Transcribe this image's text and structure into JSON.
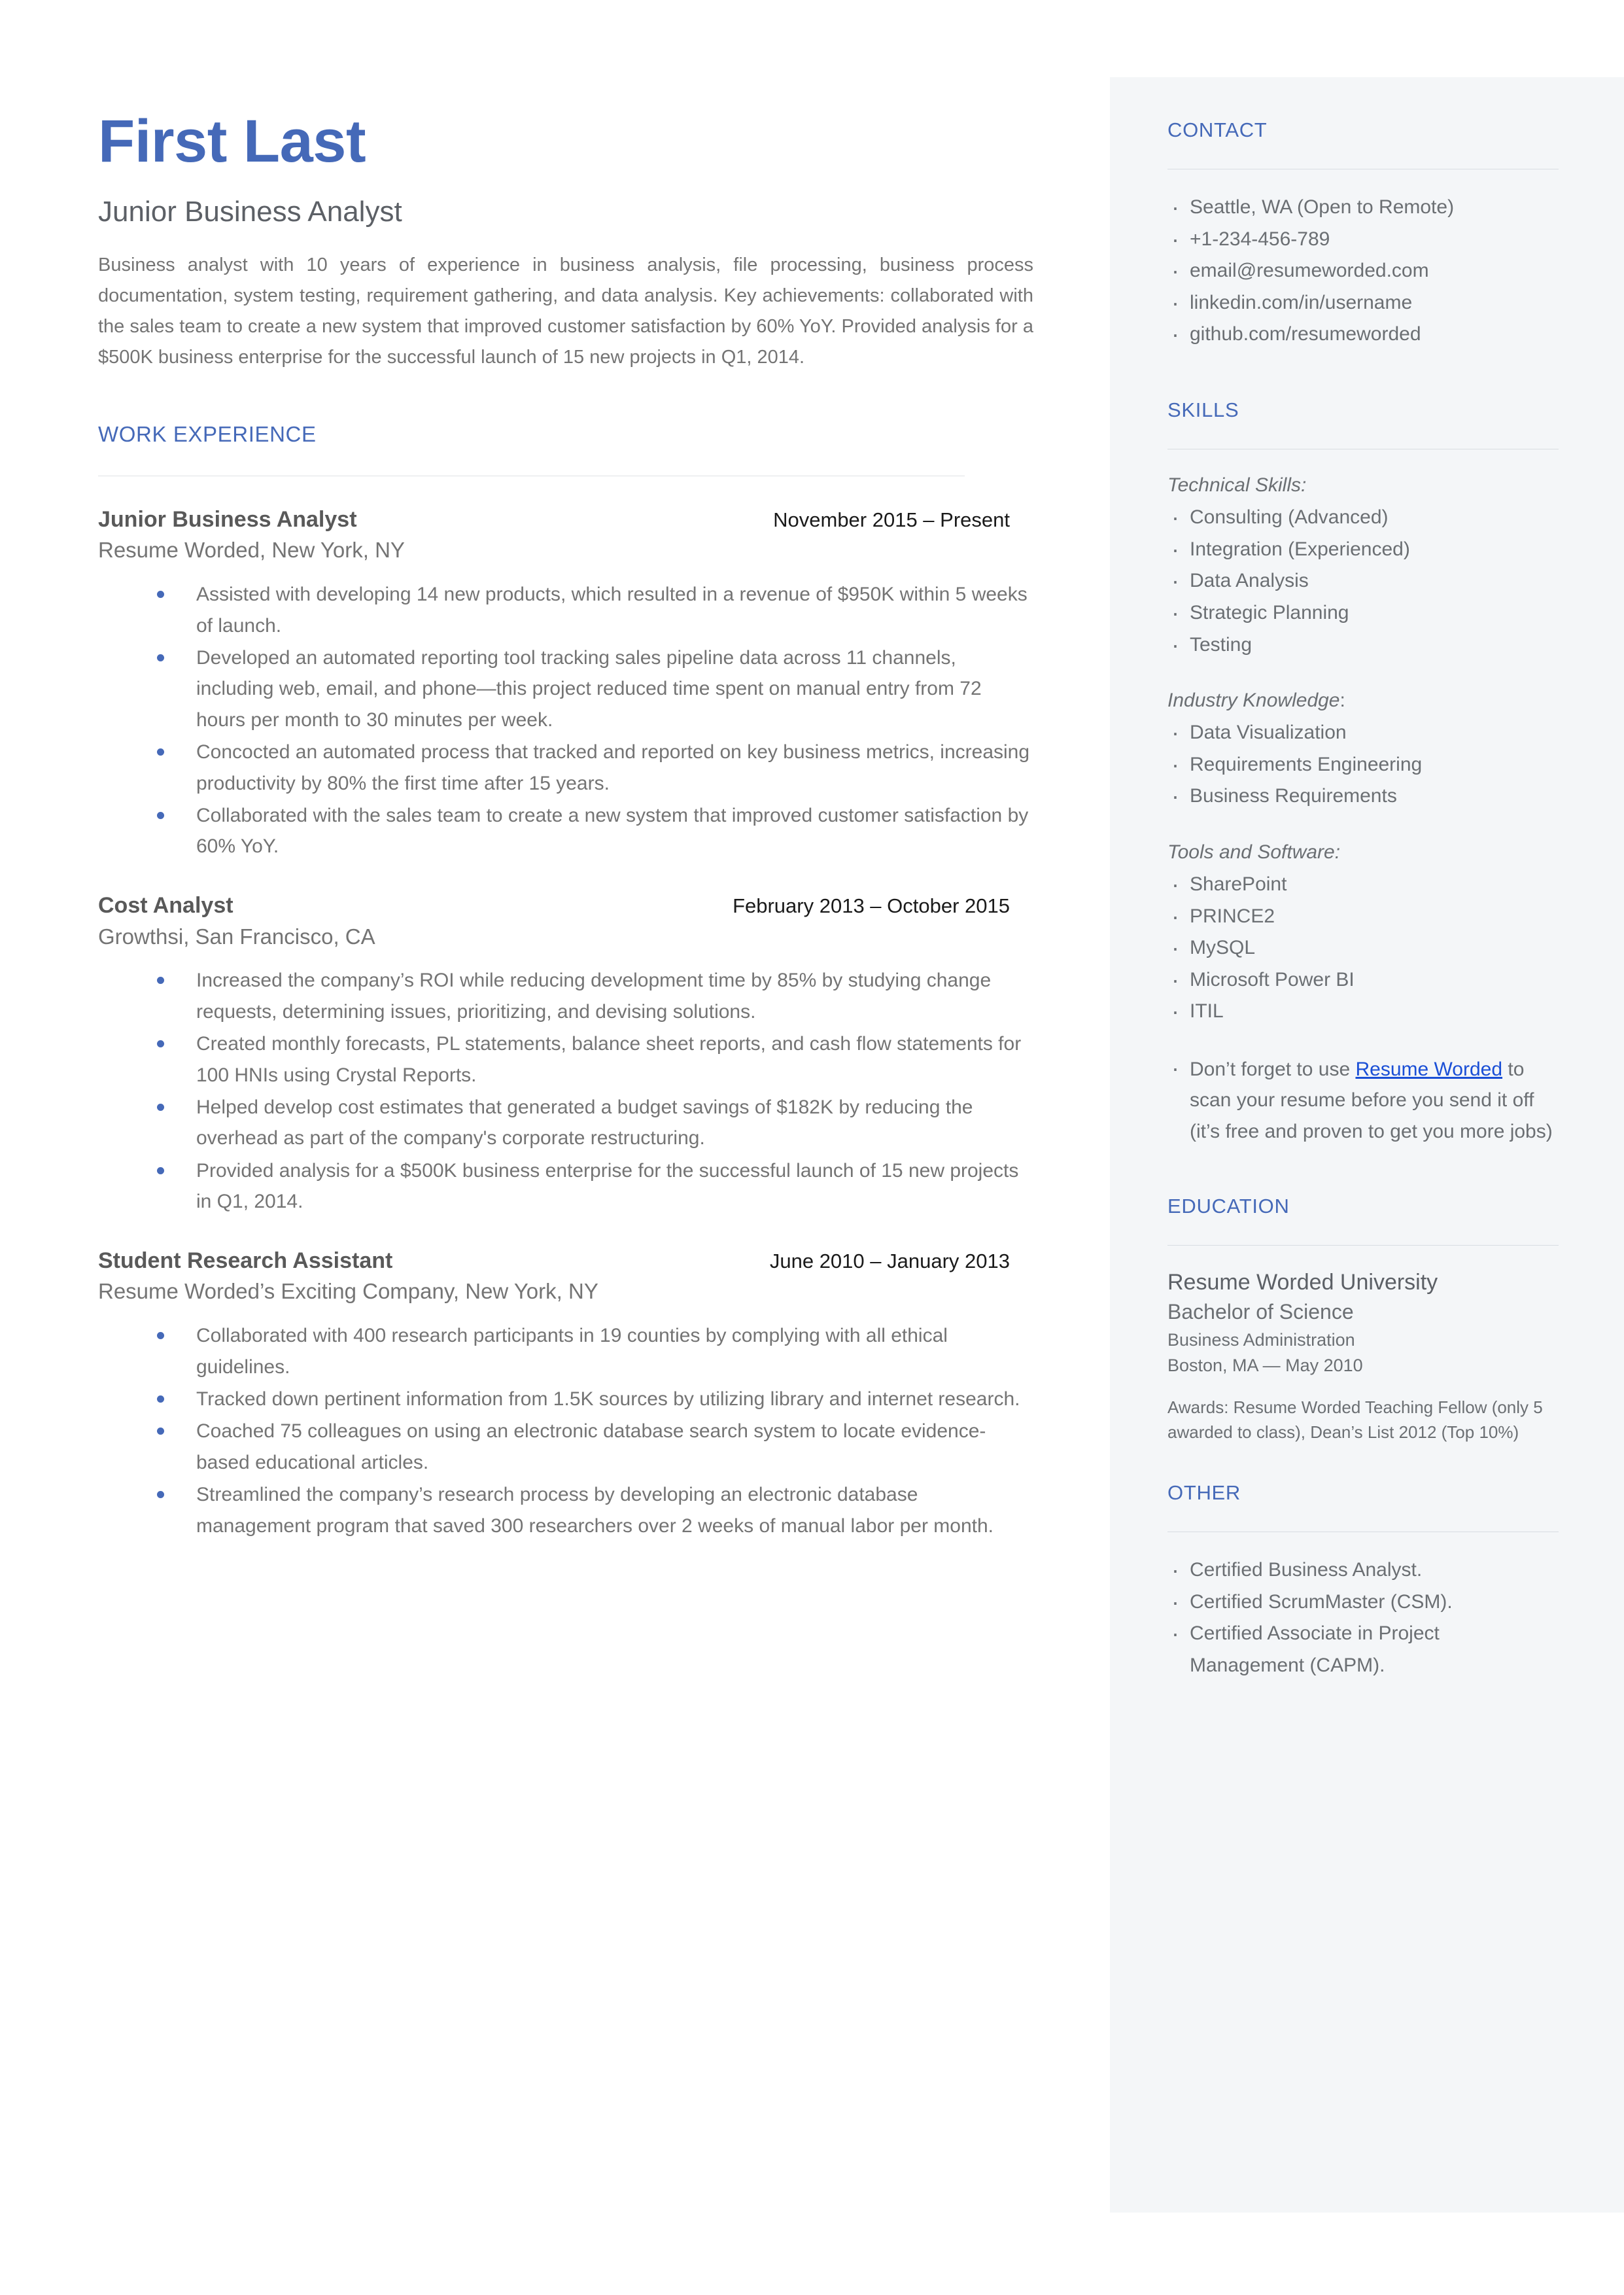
{
  "header": {
    "name": "First Last",
    "role": "Junior Business Analyst",
    "summary": "Business analyst with 10 years of experience in business analysis, file processing, business process documentation, system testing, requirement gathering, and data analysis. Key achievements: collaborated with the sales team to create a new system that improved customer satisfaction by 60% YoY. Provided analysis for a $500K business enterprise for the successful launch of 15 new projects in Q1, 2014."
  },
  "work": {
    "heading": "WORK EXPERIENCE",
    "jobs": [
      {
        "title": "Junior Business Analyst",
        "date": "November 2015 – Present",
        "company": "Resume Worded, New York, NY",
        "bullets": [
          "Assisted with developing 14 new products, which resulted in a revenue of $950K within 5 weeks of launch.",
          "Developed an automated reporting tool tracking sales pipeline data across 11 channels, including web, email, and phone—this project reduced time spent on manual entry from 72 hours per month to 30 minutes per week.",
          "Concocted an automated process that tracked and reported on key business metrics, increasing productivity by 80% the first time after 15 years.",
          "Collaborated with the sales team to create a new system that improved customer satisfaction by 60% YoY."
        ]
      },
      {
        "title": "Cost Analyst",
        "date": "February 2013 – October 2015",
        "company": "Growthsi, San Francisco, CA",
        "bullets": [
          "Increased the company’s ROI while reducing development time by 85% by studying change requests, determining issues, prioritizing, and devising solutions.",
          "Created monthly forecasts, PL statements, balance sheet reports, and cash flow statements for 100 HNIs using Crystal Reports.",
          "Helped develop cost estimates that generated a budget savings of $182K  by reducing the overhead as part of the company's corporate restructuring.",
          "Provided analysis for a $500K business enterprise for the successful launch of 15 new projects in Q1, 2014."
        ]
      },
      {
        "title": "Student Research Assistant",
        "date": "June 2010 – January 2013",
        "company": "Resume Worded’s Exciting Company, New York, NY",
        "bullets": [
          "Collaborated with 400 research participants in 19 counties by complying with all ethical guidelines.",
          "Tracked down pertinent information from 1.5K sources by utilizing library and internet research.",
          "Coached 75 colleagues on using an electronic database search system to locate evidence-based educational articles.",
          "Streamlined the company’s research process by developing an electronic database management program that saved 300 researchers over 2 weeks of manual labor per month."
        ]
      }
    ]
  },
  "contact": {
    "heading": "CONTACT",
    "items": [
      "Seattle, WA (Open to Remote)",
      "+1-234-456-789",
      "email@resumeworded.com",
      "linkedin.com/in/username",
      "github.com/resumeworded"
    ]
  },
  "skills": {
    "heading": "SKILLS",
    "groups": [
      {
        "label": "Technical Skills:",
        "items": [
          "Consulting (Advanced)",
          "Integration (Experienced)",
          "Data Analysis",
          "Strategic Planning",
          "Testing"
        ]
      },
      {
        "label": "Industry Knowledge",
        "label_suffix": ":",
        "items": [
          "Data Visualization",
          "Requirements Engineering",
          "Business Requirements"
        ]
      },
      {
        "label": "Tools and Software:",
        "items": [
          "SharePoint",
          "PRINCE2",
          "MySQL",
          "Microsoft Power BI",
          "ITIL"
        ]
      }
    ],
    "promo": {
      "before": "Don’t forget to use ",
      "link": "Resume Worded",
      "after": " to scan your resume before you send it off (it’s free and proven to get you more jobs)"
    }
  },
  "education": {
    "heading": "EDUCATION",
    "school": "Resume Worded University",
    "degree": "Bachelor of Science",
    "field": "Business Administration",
    "place": "Boston, MA — May 2010",
    "awards": "Awards: Resume Worded Teaching Fellow (only 5 awarded to class), Dean’s List 2012 (Top 10%)"
  },
  "other": {
    "heading": "OTHER",
    "items": [
      "Certified Business Analyst.",
      "Certified ScrumMaster (CSM).",
      "Certified Associate in Project Management (CAPM)."
    ]
  }
}
